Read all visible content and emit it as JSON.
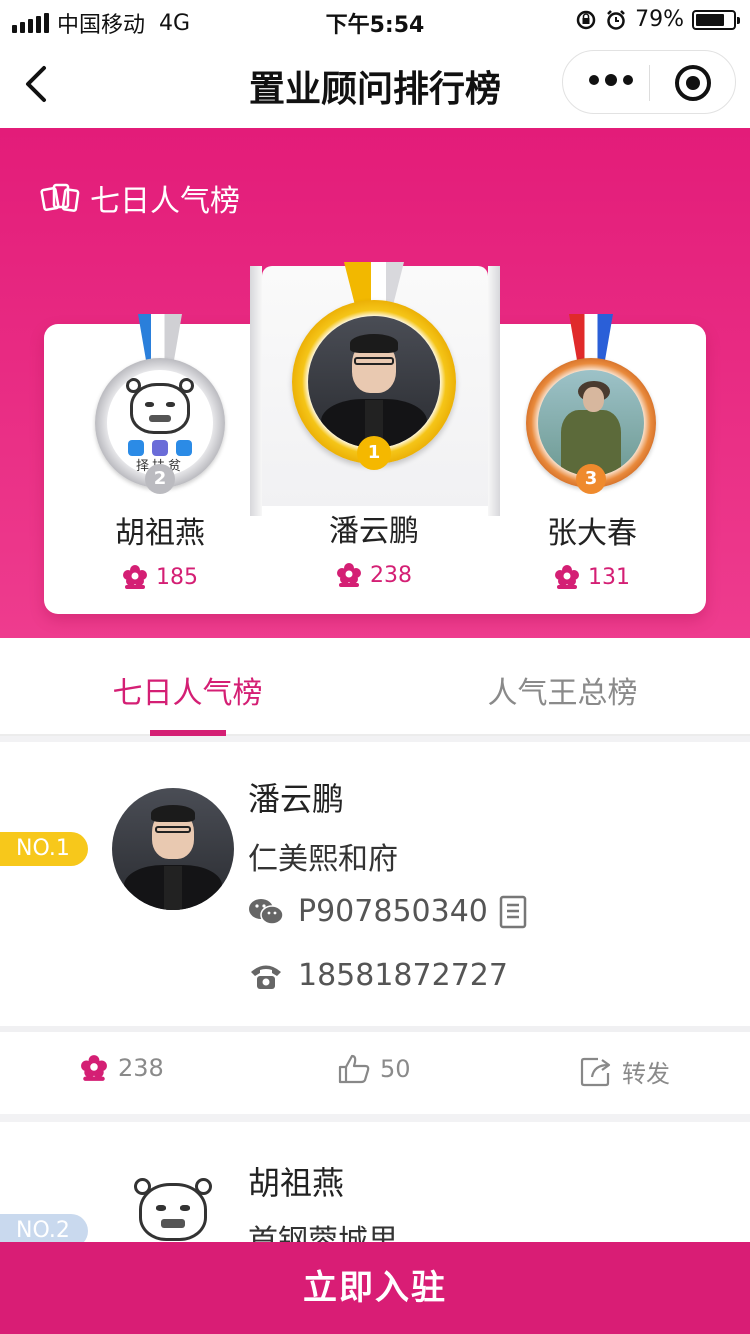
{
  "status_bar": {
    "carrier": "中国移动",
    "network": "4G",
    "time": "下午5:54",
    "battery": "79%",
    "battery_level": 0.79
  },
  "nav": {
    "title": "置业顾问排行榜"
  },
  "hero": {
    "section_title": "七日人气榜",
    "podium": [
      {
        "rank": "2",
        "name": "胡祖燕",
        "score": "185",
        "meme_caption": "择扶贫"
      },
      {
        "rank": "1",
        "name": "潘云鹏",
        "score": "238"
      },
      {
        "rank": "3",
        "name": "张大春",
        "score": "131"
      }
    ]
  },
  "tabs": {
    "active": "七日人气榜",
    "inactive": "人气王总榜"
  },
  "advisors": [
    {
      "rank_tag": "NO.1",
      "name": "潘云鹏",
      "project": "仁美熙和府",
      "wechat": "P907850340",
      "phone": "18581872727",
      "flowers": "238",
      "likes": "50",
      "share": "转发"
    },
    {
      "rank_tag": "NO.2",
      "name": "胡祖燕",
      "project": "首钢蓉城里"
    }
  ],
  "cta": {
    "label": "立即入驻"
  },
  "colors": {
    "brand": "#d91d75",
    "gold": "#f5c518",
    "silver": "#c8c8cc",
    "bronze": "#e98a3c"
  }
}
